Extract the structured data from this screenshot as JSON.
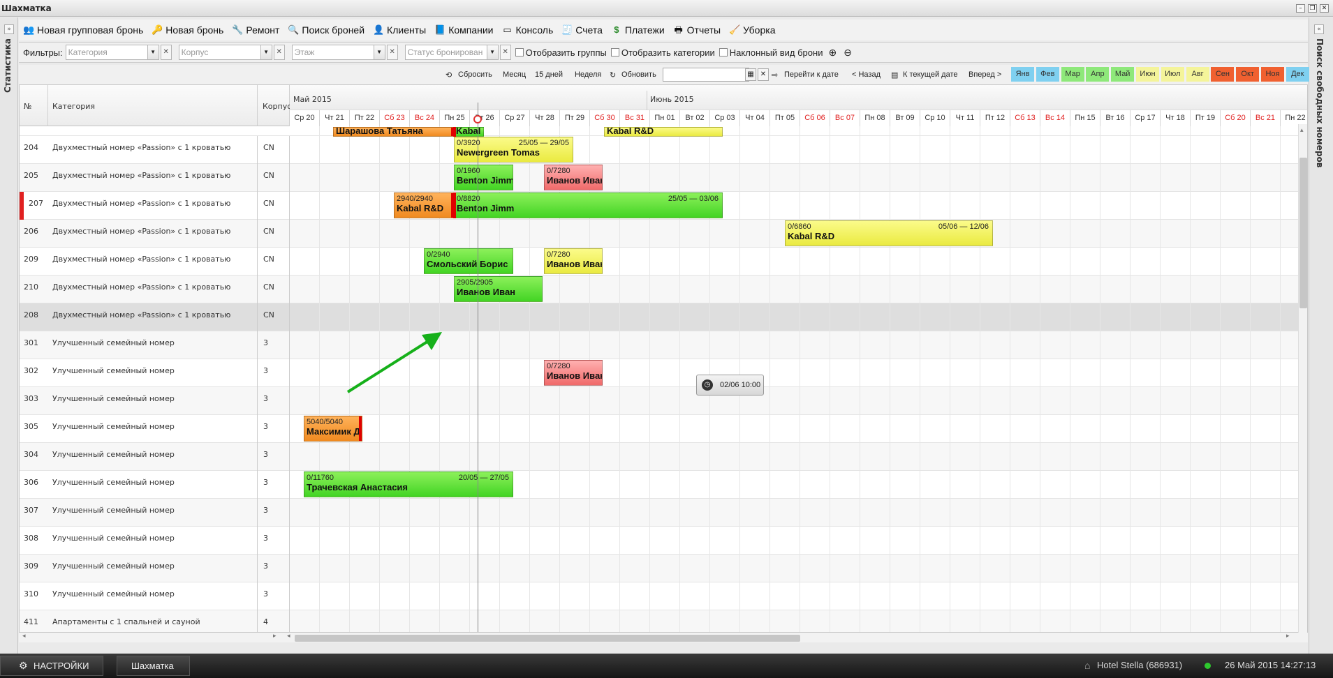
{
  "window": {
    "title": "Шахматка"
  },
  "left_panel": {
    "label": "Статистика"
  },
  "right_panel": {
    "label": "Поиск свободных номеров"
  },
  "toolbar": [
    {
      "label": "Новая групповая бронь",
      "icon": "group-icon"
    },
    {
      "label": "Новая бронь",
      "icon": "key-icon"
    },
    {
      "label": "Ремонт",
      "icon": "wrench-icon"
    },
    {
      "label": "Поиск броней",
      "icon": "search-icon"
    },
    {
      "label": "Клиенты",
      "icon": "users-icon"
    },
    {
      "label": "Компании",
      "icon": "book-icon"
    },
    {
      "label": "Консоль",
      "icon": "window-icon"
    },
    {
      "label": "Счета",
      "icon": "invoice-icon"
    },
    {
      "label": "Платежи",
      "icon": "dollar-icon"
    },
    {
      "label": "Отчеты",
      "icon": "printer-icon"
    },
    {
      "label": "Уборка",
      "icon": "broom-icon"
    }
  ],
  "filters": {
    "label": "Фильтры:",
    "category_placeholder": "Категория",
    "building_placeholder": "Корпус",
    "floor_placeholder": "Этаж",
    "status_placeholder": "Статус бронирован",
    "show_groups": "Отобразить группы",
    "show_categories": "Отобразить категории",
    "tilted_view": "Наклонный вид брони"
  },
  "nav": {
    "reset": "Сбросить",
    "month": "Месяц",
    "days15": "15 дней",
    "week": "Неделя",
    "refresh": "Обновить",
    "goto_date": "Перейти к дате",
    "back": "< Назад",
    "today": "К текущей дате",
    "forward": "Вперед >"
  },
  "months": [
    {
      "label": "Янв",
      "color": "#7fd0f0"
    },
    {
      "label": "Фев",
      "color": "#7fd0f0"
    },
    {
      "label": "Мар",
      "color": "#8ee87a"
    },
    {
      "label": "Апр",
      "color": "#8ee87a"
    },
    {
      "label": "Май",
      "color": "#8ee87a"
    },
    {
      "label": "Июн",
      "color": "#f4f49a"
    },
    {
      "label": "Июл",
      "color": "#f4f49a"
    },
    {
      "label": "Авг",
      "color": "#f4f49a"
    },
    {
      "label": "Сен",
      "color": "#f06030"
    },
    {
      "label": "Окт",
      "color": "#f06030"
    },
    {
      "label": "Ноя",
      "color": "#f06030"
    },
    {
      "label": "Дек",
      "color": "#7fd0f0"
    }
  ],
  "grid": {
    "col_num": "№",
    "col_category": "Категория",
    "col_building": "Корпус",
    "month1": "Май 2015",
    "month2": "Июнь 2015",
    "days": [
      {
        "label": "Ср 20",
        "weekend": false
      },
      {
        "label": "Чт 21",
        "weekend": false
      },
      {
        "label": "Пт 22",
        "weekend": false
      },
      {
        "label": "Сб 23",
        "weekend": true
      },
      {
        "label": "Вс 24",
        "weekend": true
      },
      {
        "label": "Пн 25",
        "weekend": false
      },
      {
        "label": "Вт 26",
        "weekend": false
      },
      {
        "label": "Ср 27",
        "weekend": false
      },
      {
        "label": "Чт 28",
        "weekend": false
      },
      {
        "label": "Пт 29",
        "weekend": false
      },
      {
        "label": "Сб 30",
        "weekend": true
      },
      {
        "label": "Вс 31",
        "weekend": true
      },
      {
        "label": "Пн 01",
        "weekend": false
      },
      {
        "label": "Вт 02",
        "weekend": false
      },
      {
        "label": "Ср 03",
        "weekend": false
      },
      {
        "label": "Чт 04",
        "weekend": false
      },
      {
        "label": "Пт 05",
        "weekend": false
      },
      {
        "label": "Сб 06",
        "weekend": true
      },
      {
        "label": "Вс 07",
        "weekend": true
      },
      {
        "label": "Пн 08",
        "weekend": false
      },
      {
        "label": "Вт 09",
        "weekend": false
      },
      {
        "label": "Ср 10",
        "weekend": false
      },
      {
        "label": "Чт 11",
        "weekend": false
      },
      {
        "label": "Пт 12",
        "weekend": false
      },
      {
        "label": "Сб 13",
        "weekend": true
      },
      {
        "label": "Вс 14",
        "weekend": true
      },
      {
        "label": "Пн 15",
        "weekend": false
      },
      {
        "label": "Вт 16",
        "weekend": false
      },
      {
        "label": "Ср 17",
        "weekend": false
      },
      {
        "label": "Чт 18",
        "weekend": false
      },
      {
        "label": "Пт 19",
        "weekend": false
      },
      {
        "label": "Сб 20",
        "weekend": true
      },
      {
        "label": "Вс 21",
        "weekend": true
      },
      {
        "label": "Пн 22",
        "weekend": false
      }
    ],
    "rows": [
      {
        "num": "204",
        "category": "Двухместный номер «Passion» с 1 кроватью",
        "building": "CN"
      },
      {
        "num": "205",
        "category": "Двухместный номер «Passion» с 1 кроватью",
        "building": "CN"
      },
      {
        "num": "207",
        "category": "Двухместный номер «Passion» с 1 кроватью",
        "building": "CN"
      },
      {
        "num": "206",
        "category": "Двухместный номер «Passion» с 1 кроватью",
        "building": "CN"
      },
      {
        "num": "209",
        "category": "Двухместный номер «Passion» с 1 кроватью",
        "building": "CN"
      },
      {
        "num": "210",
        "category": "Двухместный номер «Passion» с 1 кроватью",
        "building": "CN"
      },
      {
        "num": "208",
        "category": "Двухместный номер «Passion» с 1 кроватью",
        "building": "CN"
      },
      {
        "num": "301",
        "category": "Улучшенный семейный номер",
        "building": "3"
      },
      {
        "num": "302",
        "category": "Улучшенный семейный номер",
        "building": "3"
      },
      {
        "num": "303",
        "category": "Улучшенный семейный номер",
        "building": "3"
      },
      {
        "num": "305",
        "category": "Улучшенный семейный номер",
        "building": "3"
      },
      {
        "num": "304",
        "category": "Улучшенный семейный номер",
        "building": "3"
      },
      {
        "num": "306",
        "category": "Улучшенный семейный номер",
        "building": "3"
      },
      {
        "num": "307",
        "category": "Улучшенный семейный номер",
        "building": "3"
      },
      {
        "num": "308",
        "category": "Улучшенный семейный номер",
        "building": "3"
      },
      {
        "num": "309",
        "category": "Улучшенный семейный номер",
        "building": "3"
      },
      {
        "num": "310",
        "category": "Улучшенный семейный номер",
        "building": "3"
      },
      {
        "num": "411",
        "category": "Апартаменты с 1 спальней и сауной",
        "building": "4"
      }
    ],
    "bookings": [
      {
        "name": "Шарашова Татьяна",
        "amount": "",
        "dates": "",
        "color": "orange"
      },
      {
        "name": "Kabal",
        "amount": "",
        "dates": "",
        "color": "green"
      },
      {
        "name": "Kabal R&D",
        "amount": "",
        "dates": "",
        "color": "yellow"
      },
      {
        "name": "Newergreen Tomas",
        "amount": "0/3920",
        "dates": "25/05 — 29/05",
        "color": "yellow"
      },
      {
        "name": "Benton Jimm",
        "amount": "0/1960",
        "dates": "",
        "color": "green"
      },
      {
        "name": "Иванов Иван",
        "amount": "0/7280",
        "dates": "",
        "color": "pink"
      },
      {
        "name": "Kabal R&D",
        "amount": "2940/2940",
        "dates": "",
        "color": "orange"
      },
      {
        "name": "Benton Jimm",
        "amount": "0/8820",
        "dates": "25/05 — 03/06",
        "color": "green"
      },
      {
        "name": "Kabal R&D",
        "amount": "0/6860",
        "dates": "05/06 — 12/06",
        "color": "yellow"
      },
      {
        "name": "Смольский Борис",
        "amount": "0/2940",
        "dates": "",
        "color": "green"
      },
      {
        "name": "Иванов Иван",
        "amount": "0/7280",
        "dates": "",
        "color": "yellow"
      },
      {
        "name": "Иванов Иван",
        "amount": "2905/2905",
        "dates": "",
        "color": "green"
      },
      {
        "name": "Иванов Иван",
        "amount": "0/7280",
        "dates": "",
        "color": "pink"
      },
      {
        "name": "Максимик Д",
        "amount": "5040/5040",
        "dates": "",
        "color": "orange"
      },
      {
        "name": "Трачевская Анастасия",
        "amount": "0/11760",
        "dates": "20/05 — 27/05",
        "color": "green"
      }
    ]
  },
  "tooltip": {
    "text": "02/06 10:00"
  },
  "taskbar": {
    "settings": "НАСТРОЙКИ",
    "tab": "Шахматка",
    "hotel": "Hotel Stella (686931)",
    "datetime": "26 Май 2015 14:27:13"
  }
}
